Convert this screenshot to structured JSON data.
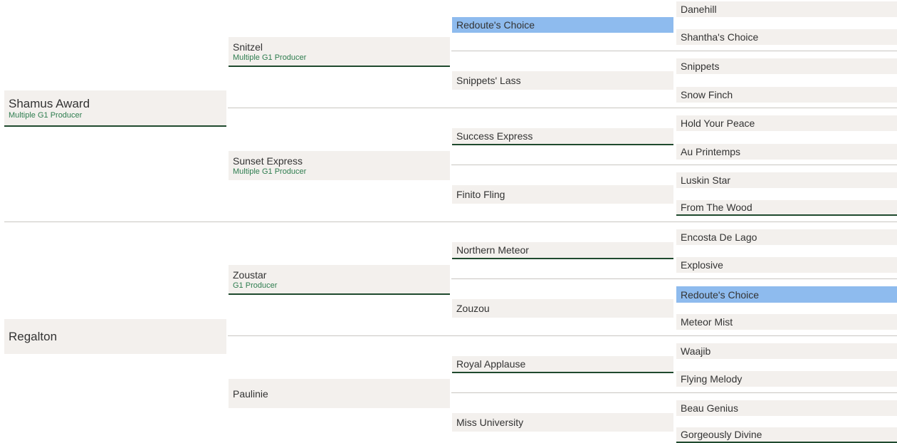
{
  "pedigree": {
    "sire": {
      "name": "Shamus Award",
      "subtitle": "Multiple G1 Producer",
      "sire": {
        "name": "Snitzel",
        "subtitle": "Multiple G1 Producer",
        "sire": {
          "name": "Redoute's Choice",
          "sire": {
            "name": "Danehill"
          },
          "dam": {
            "name": "Shantha's Choice"
          }
        },
        "dam": {
          "name": "Snippets' Lass",
          "sire": {
            "name": "Snippets"
          },
          "dam": {
            "name": "Snow Finch"
          }
        }
      },
      "dam": {
        "name": "Sunset Express",
        "subtitle": "Multiple G1 Producer",
        "sire": {
          "name": "Success Express",
          "sire": {
            "name": "Hold Your Peace"
          },
          "dam": {
            "name": "Au Printemps"
          }
        },
        "dam": {
          "name": "Finito Fling",
          "sire": {
            "name": "Luskin Star"
          },
          "dam": {
            "name": "From The Wood"
          }
        }
      }
    },
    "dam": {
      "name": "Regalton",
      "sire": {
        "name": "Zoustar",
        "subtitle": "G1 Producer",
        "sire": {
          "name": "Northern Meteor",
          "sire": {
            "name": "Encosta De Lago"
          },
          "dam": {
            "name": "Explosive"
          }
        },
        "dam": {
          "name": "Zouzou",
          "sire": {
            "name": "Redoute's Choice"
          },
          "dam": {
            "name": "Meteor Mist"
          }
        }
      },
      "dam": {
        "name": "Paulinie",
        "sire": {
          "name": "Royal Applause",
          "sire": {
            "name": "Waajib"
          },
          "dam": {
            "name": "Flying Melody"
          }
        },
        "dam": {
          "name": "Miss University",
          "sire": {
            "name": "Beau Genius"
          },
          "dam": {
            "name": "Gorgeously Divine"
          }
        }
      }
    }
  },
  "colors": {
    "cell_background": "#f3f0ed",
    "highlight": "#8ebbee",
    "accent_underline": "#1f4a2e",
    "subtitle_text": "#2e7d4f",
    "divider": "#c9c6c1"
  }
}
